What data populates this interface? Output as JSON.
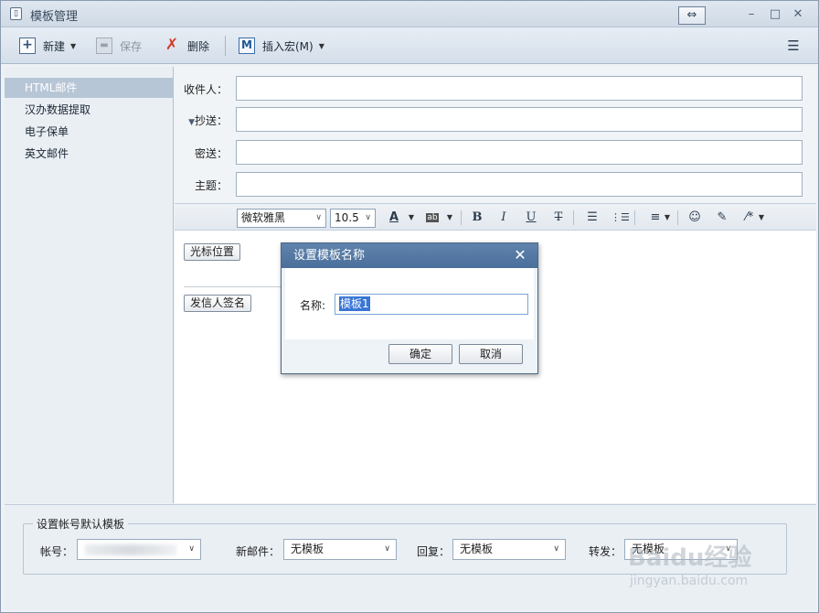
{
  "window": {
    "title": "模板管理"
  },
  "toolbar": {
    "new_label": "新建",
    "save_label": "保存",
    "delete_label": "删除",
    "macro_label": "插入宏(M)",
    "macro_icon_text": "M"
  },
  "sidebar": {
    "items": [
      {
        "label": "HTML邮件"
      },
      {
        "label": "汉办数据提取"
      },
      {
        "label": "电子保单"
      },
      {
        "label": "英文邮件"
      }
    ]
  },
  "form": {
    "to_label": "收件人：",
    "cc_label": "抄送：",
    "bcc_label": "密送：",
    "subject_label": "主题：",
    "to_value": "",
    "cc_value": "",
    "bcc_value": "",
    "subject_value": ""
  },
  "format_bar": {
    "font_family": "微软雅黑",
    "font_size": "10.5"
  },
  "editor": {
    "cursor_button": "光标位置",
    "signature_button": "发信人签名"
  },
  "dialog": {
    "title": "设置模板名称",
    "name_label": "名称:",
    "name_value": "模板1",
    "ok_label": "确定",
    "cancel_label": "取消"
  },
  "defaults": {
    "group_title": "设置帐号默认模板",
    "account_label": "帐号：",
    "new_mail_label": "新邮件：",
    "new_mail_value": "无模板",
    "reply_label": "回复：",
    "reply_value": "无模板",
    "forward_label": "转发：",
    "forward_value": "无模板"
  },
  "watermark": {
    "brand": "Baidu经验",
    "url": "jingyan.baidu.com"
  }
}
